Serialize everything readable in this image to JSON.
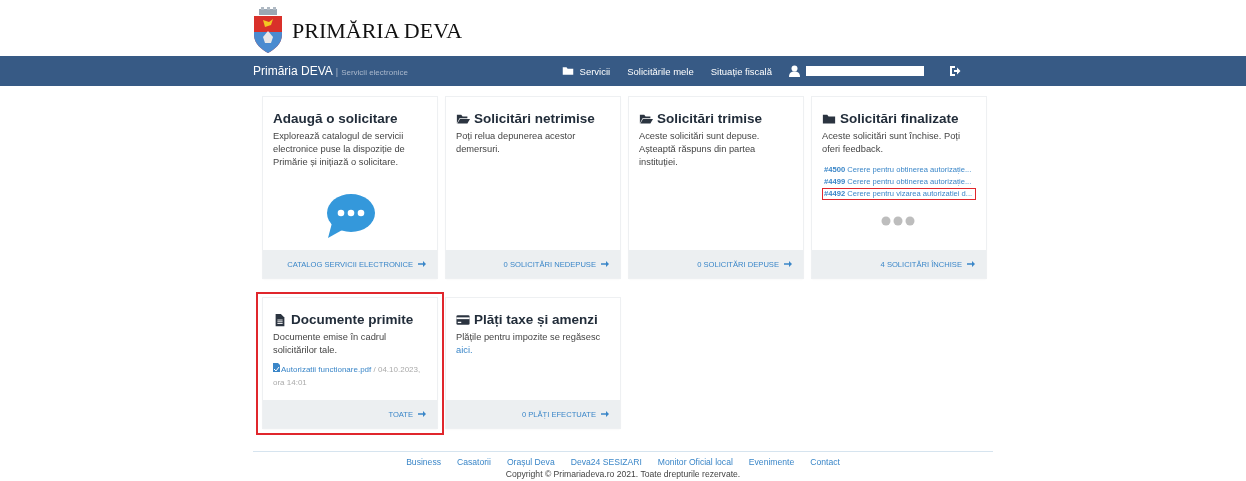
{
  "header": {
    "title": "PRIMĂRIA DEVA"
  },
  "navbar": {
    "brand": "Primăria DEVA",
    "separator": "|",
    "subtitle": "Servicii electronice",
    "items": [
      {
        "label": "Servicii",
        "kind": "services"
      },
      {
        "label": "Solicitările mele"
      },
      {
        "label": "Situație fiscală"
      }
    ]
  },
  "cards": [
    {
      "kind": "intro",
      "title": "Adaugă o solicitare",
      "text": "Explorează catalogul de servicii electronice puse la dispoziție de Primărie și inițiază o solicitare.",
      "footer_link": "CATALOG SERVICII ELECTRONICE",
      "highlighted": false
    },
    {
      "kind": "unsent",
      "title": "Solicitări netrimise",
      "text": "Poți relua depunerea acestor demersuri.",
      "footer_link": "0 SOLICITĂRI NEDEPUSE",
      "highlighted": false
    },
    {
      "kind": "sent",
      "title": "Solicitări trimise",
      "text": "Aceste solicitări sunt depuse. Așteaptă răspuns din partea instituției.",
      "footer_link": "0 SOLICITĂRI DEPUSE",
      "highlighted": false
    },
    {
      "kind": "finished",
      "title": "Solicitări finalizate",
      "text": "Aceste solicitări sunt închise. Poți oferi feedback.",
      "requests": [
        {
          "number": "#4500",
          "title": "Cerere pentru obtinerea autorizație...",
          "highlighted": false
        },
        {
          "number": "#4499",
          "title": "Cerere pentru obtinerea autorizație...",
          "highlighted": false
        },
        {
          "number": "#4492",
          "title": "Cerere pentru vizarea autorizatiei d...",
          "highlighted": true
        }
      ],
      "more": true,
      "footer_link": "4 SOLICITĂRI ÎNCHISE",
      "highlighted": false
    },
    {
      "kind": "documents",
      "title": "Documente primite",
      "text": "Documente emise în cadrul solicitărilor tale.",
      "files": [
        {
          "name": "Autorizatii functionare.pdf",
          "date": "/ 04.10.2023,",
          "time": "ora 14:01"
        }
      ],
      "footer_link": "TOATE",
      "highlighted": true
    },
    {
      "kind": "payments",
      "title": "Plăți taxe și amenzi",
      "text": "Plățile pentru impozite se regăsesc",
      "inline_link": "aici.",
      "footer_link": "0 PLĂȚI EFECTUATE",
      "highlighted": false
    }
  ],
  "footer": {
    "links": [
      "Business",
      "Casatorii",
      "Orașul Deva",
      "Deva24 SESIZARI",
      "Monitor Oficial local",
      "Evenimente",
      "Contact"
    ],
    "copyright": "Copyright © Primariadeva.ro 2021. Toate drepturile rezervate."
  }
}
